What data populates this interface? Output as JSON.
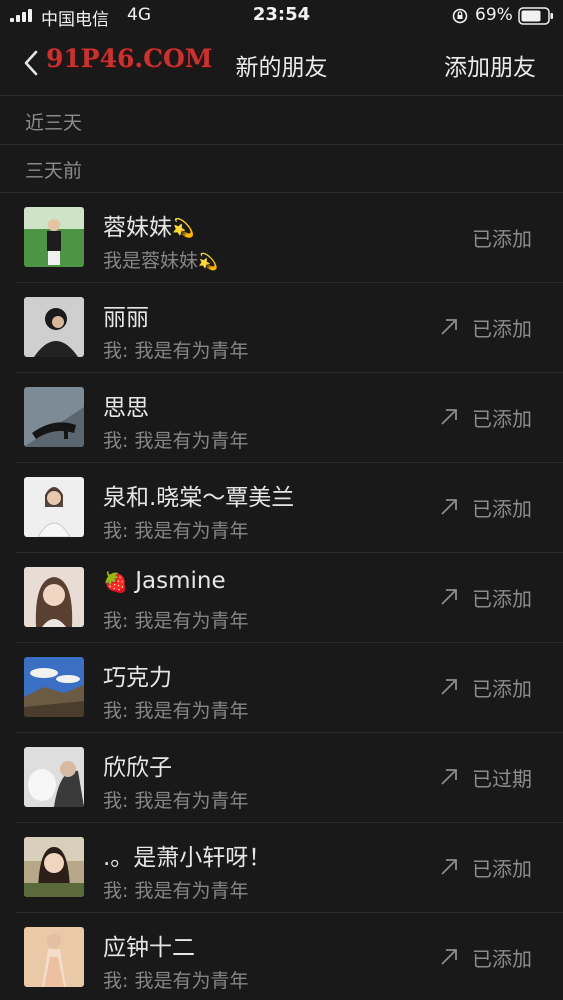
{
  "status_bar": {
    "carrier": "中国电信",
    "network": "4G",
    "time": "23:54",
    "battery": "69%"
  },
  "nav": {
    "watermark": "91P46.COM",
    "title": "新的朋友",
    "add_friend": "添加朋友"
  },
  "sections": {
    "recent": "近三天",
    "older": "三天前"
  },
  "friends": [
    {
      "name": "蓉妹妹",
      "message": "我是蓉妹妹",
      "status": "已添加",
      "emoji_name": "💫",
      "emoji_msg": "💫",
      "arrow": false
    },
    {
      "name": "丽丽",
      "message": "我: 我是有为青年",
      "status": "已添加",
      "arrow": true
    },
    {
      "name": "思思",
      "message": "我: 我是有为青年",
      "status": "已添加",
      "arrow": true
    },
    {
      "name": "泉和.晓棠～覃美兰",
      "message": "我: 我是有为青年",
      "status": "已添加",
      "arrow": true
    },
    {
      "name": "Jasmine",
      "message": "我: 我是有为青年",
      "status": "已添加",
      "emoji_prefix": "🍓",
      "arrow": true
    },
    {
      "name": "巧克力",
      "message": "我: 我是有为青年",
      "status": "已添加",
      "arrow": true
    },
    {
      "name": "欣欣子",
      "message": "我: 我是有为青年",
      "status": "已过期",
      "arrow": true
    },
    {
      "name": ".。是萧小轩呀！",
      "message": "我: 我是有为青年",
      "status": "已添加",
      "arrow": true
    },
    {
      "name": "应钟十二",
      "message": "我: 我是有为青年",
      "status": "已添加",
      "arrow": true
    }
  ]
}
